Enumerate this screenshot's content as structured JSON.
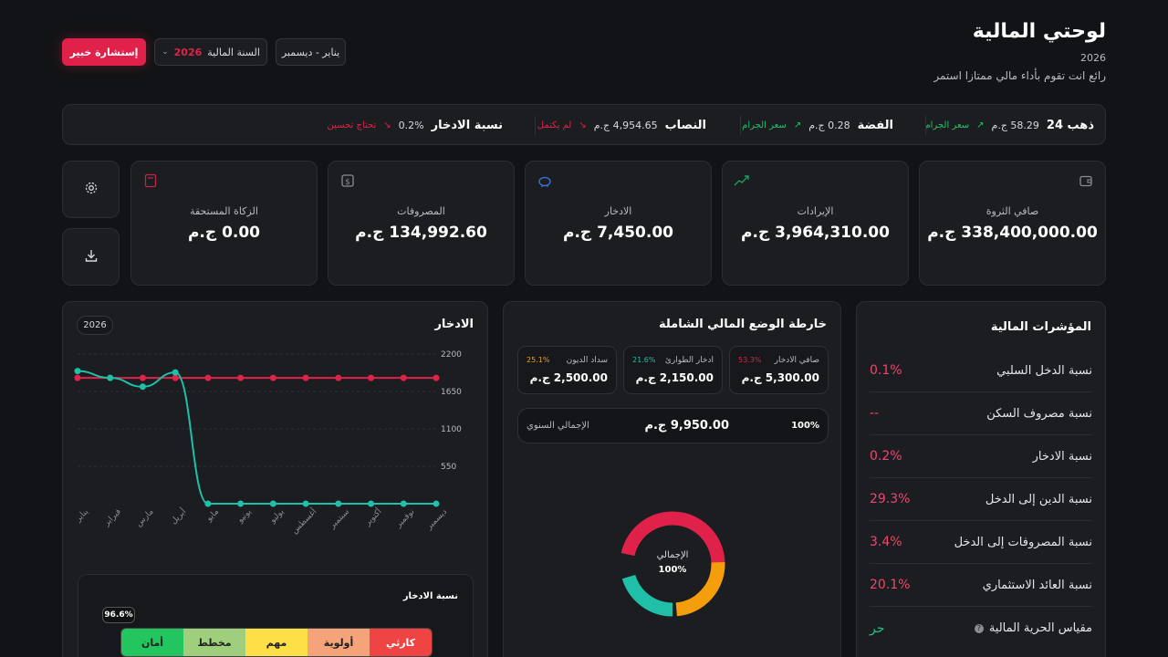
{
  "header": {
    "title": "لوحتي المالية",
    "year": "2026",
    "tagline": "رائع انت تقوم بأداء مالي ممتازا استمر",
    "consult_label": "إستشارة خبير",
    "year_select_label": "السنة المالية",
    "year_select_value": "2026",
    "period_label": "يناير - ديسمبر"
  },
  "ticker": [
    {
      "label": "ذهب 24",
      "value": "58.29 ج.م",
      "note": "سعر الجرام",
      "trend": "up"
    },
    {
      "label": "الفضة",
      "value": "0.28 ج.م",
      "note": "سعر الجرام",
      "trend": "up"
    },
    {
      "label": "النصاب",
      "value": "4,954.65 ج.م",
      "note": "لم يكتمل",
      "trend": "down"
    },
    {
      "label": "نسبة الادخار",
      "value": "0.2%",
      "note": "تحتاج تحسين",
      "trend": "down"
    }
  ],
  "stats": [
    {
      "label": "صافي الثروة",
      "value": "338,400,000.00 ج.م",
      "icon": "wallet-icon",
      "color": "#8a8d93"
    },
    {
      "label": "الإيرادات",
      "value": "3,964,310.00 ج.م",
      "icon": "trend-up-icon",
      "color": "#1f9d5a"
    },
    {
      "label": "الادخار",
      "value": "7,450.00 ج.م",
      "icon": "piggy-bank-icon",
      "color": "#3b6fd1"
    },
    {
      "label": "المصروفات",
      "value": "134,992.60 ج.م",
      "icon": "dollar-icon",
      "color": "#8a8d93"
    },
    {
      "label": "الزكاة المستحقة",
      "value": "0.00 ج.م",
      "icon": "calculator-icon",
      "color": "#c22446"
    }
  ],
  "actions": {
    "settings_icon": "gear-icon",
    "download_icon": "download-icon"
  },
  "indicators": {
    "title": "المؤشرات المالية",
    "rows": [
      {
        "name": "نسبة الدخل السلبي",
        "value": "0.1%",
        "color": "#f0456d"
      },
      {
        "name": "نسبة مصروف السكن",
        "value": "--",
        "color": "#f0456d"
      },
      {
        "name": "نسبة الادخار",
        "value": "0.2%",
        "color": "#f0456d"
      },
      {
        "name": "نسبة الدين إلى الدخل",
        "value": "29.3%",
        "color": "#f0456d"
      },
      {
        "name": "نسبة المصروفات إلى الدخل",
        "value": "3.4%",
        "color": "#f0456d"
      },
      {
        "name": "نسبة العائد الاستثماري",
        "value": "20.1%",
        "color": "#f0456d"
      },
      {
        "name": "مقياس الحرية المالية",
        "value": "حر",
        "color": "#21c28a",
        "help": "?"
      }
    ]
  },
  "fin_map": {
    "title": "خارطة الوضع المالي الشاملة",
    "cards": [
      {
        "label": "صافي الادخار",
        "pct": "53.3%",
        "value": "5,300.00 ج.م",
        "color": "#e0224b"
      },
      {
        "label": "ادخار الطوارئ",
        "pct": "21.6%",
        "value": "2,150.00 ج.م",
        "color": "#1fbfa8"
      },
      {
        "label": "سداد الديون",
        "pct": "25.1%",
        "value": "2,500.00 ج.م",
        "color": "#f59e0b"
      }
    ],
    "total_label": "الإجمالي السنوي",
    "total_value": "9,950.00 ج.م",
    "total_pct": "100%",
    "donut_label": "الإجمالي",
    "donut_pct": "100%"
  },
  "savings": {
    "title": "الادخار",
    "year_badge": "2026",
    "gauge_title": "نسبة الادخار",
    "gauge_value": "96.6%",
    "gauge_segments": [
      {
        "label": "كارثي",
        "color": "#ef4444"
      },
      {
        "label": "أولوية",
        "color": "#f4a37a"
      },
      {
        "label": "مهم",
        "color": "#fde047"
      },
      {
        "label": "مخطط",
        "color": "#9fce7c"
      },
      {
        "label": "أمان",
        "color": "#22c55e"
      }
    ]
  },
  "chart_data": {
    "type": "line",
    "title": "الادخار",
    "categories": [
      "يناير",
      "فبراير",
      "مارس",
      "أبريل",
      "مايو",
      "يونيو",
      "يوليو",
      "أغسطس",
      "سبتمبر",
      "أكتوبر",
      "نوفمبر",
      "ديسمبر"
    ],
    "y_ticks": [
      550,
      1100,
      1650,
      2200
    ],
    "ylim": [
      0,
      2200
    ],
    "grid": true,
    "series": [
      {
        "values": [
          1850,
          1850,
          1850,
          1850,
          1850,
          1850,
          1850,
          1850,
          1850,
          1850,
          1850,
          1850
        ],
        "color": "#e0224b"
      },
      {
        "values": [
          1950,
          1850,
          1720,
          1930,
          0,
          0,
          0,
          0,
          0,
          0,
          0,
          0
        ],
        "color": "#1fbfa8"
      }
    ]
  }
}
